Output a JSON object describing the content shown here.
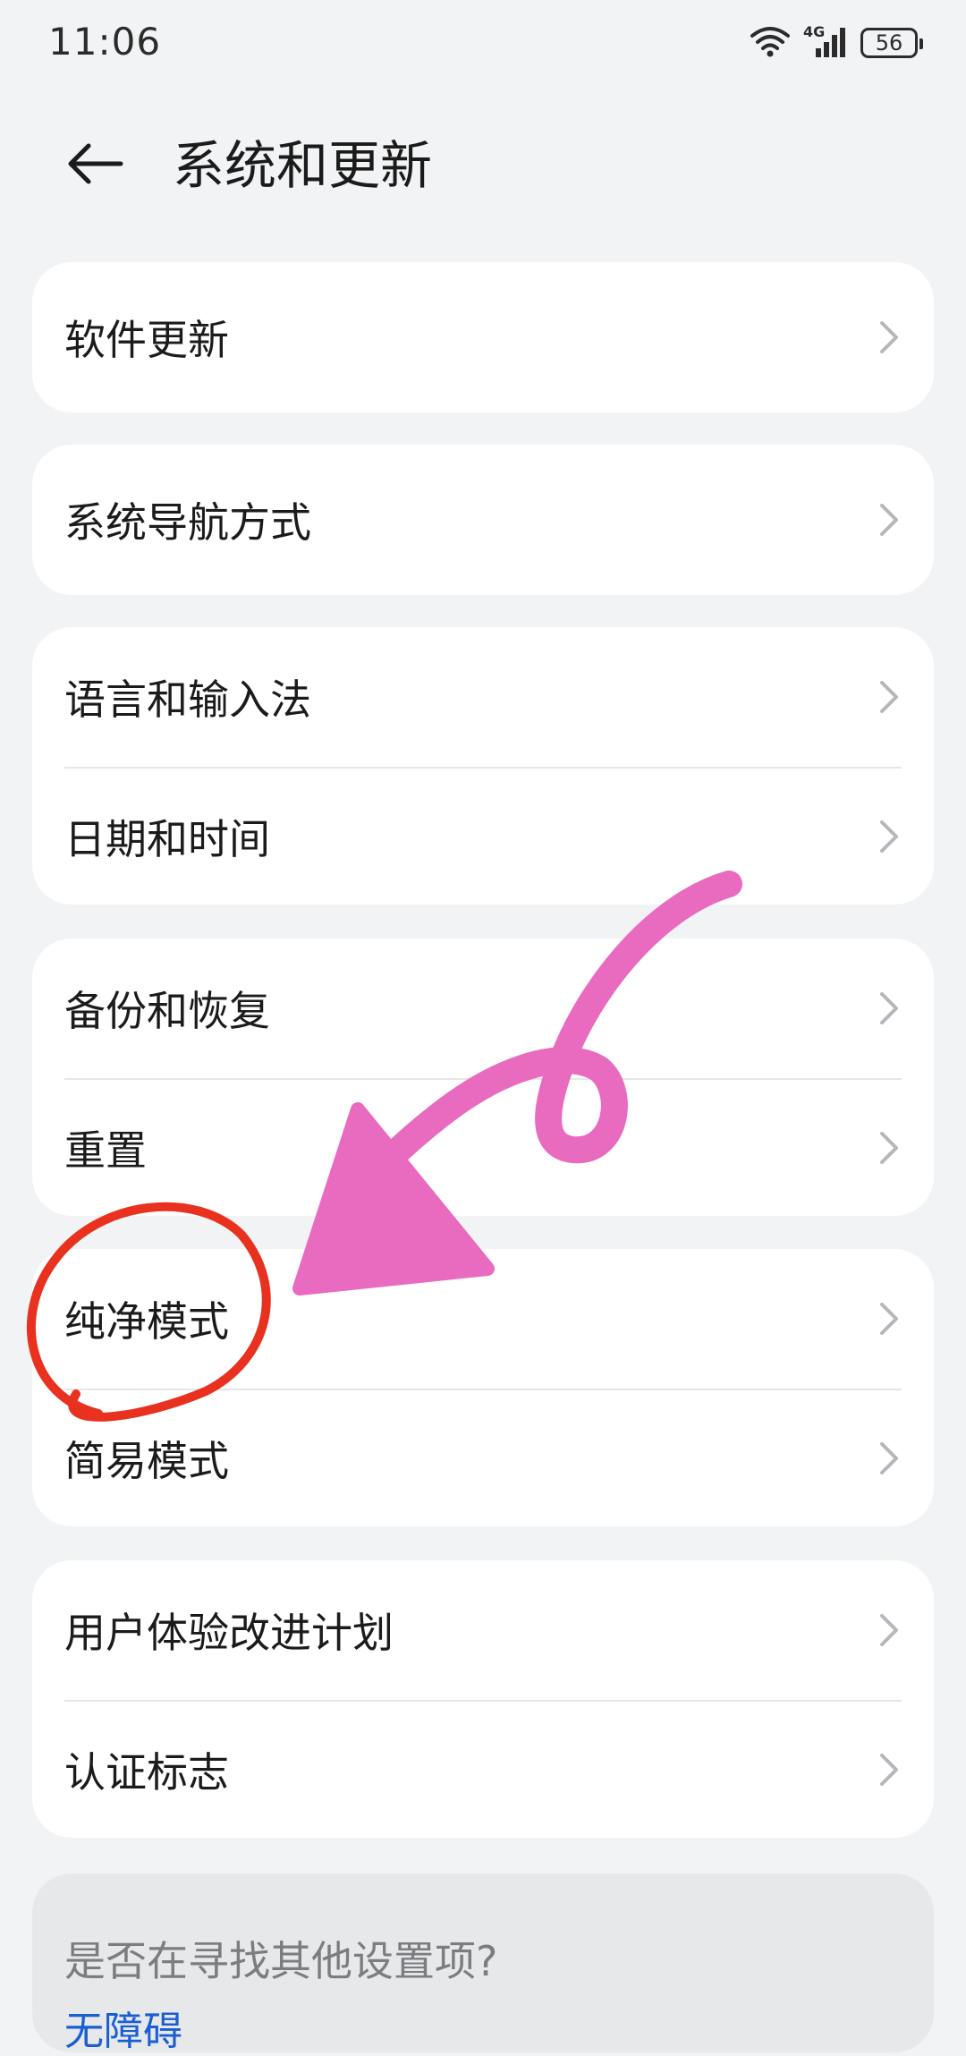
{
  "status_bar": {
    "time": "11:06",
    "network": "4G",
    "battery": "56"
  },
  "header": {
    "title": "系统和更新"
  },
  "groups": [
    {
      "items": [
        {
          "label": "软件更新"
        }
      ]
    },
    {
      "items": [
        {
          "label": "系统导航方式"
        }
      ]
    },
    {
      "items": [
        {
          "label": "语言和输入法"
        },
        {
          "label": "日期和时间"
        }
      ]
    },
    {
      "items": [
        {
          "label": "备份和恢复"
        },
        {
          "label": "重置"
        }
      ]
    },
    {
      "items": [
        {
          "label": "纯净模式"
        },
        {
          "label": "简易模式"
        }
      ]
    },
    {
      "items": [
        {
          "label": "用户体验改进计划"
        },
        {
          "label": "认证标志"
        }
      ]
    }
  ],
  "search_prompt": {
    "question": "是否在寻找其他设置项?",
    "link": "无障碍"
  },
  "annotations": {
    "arrow_color": "#e96bc0",
    "circle_color": "#e8321f"
  }
}
